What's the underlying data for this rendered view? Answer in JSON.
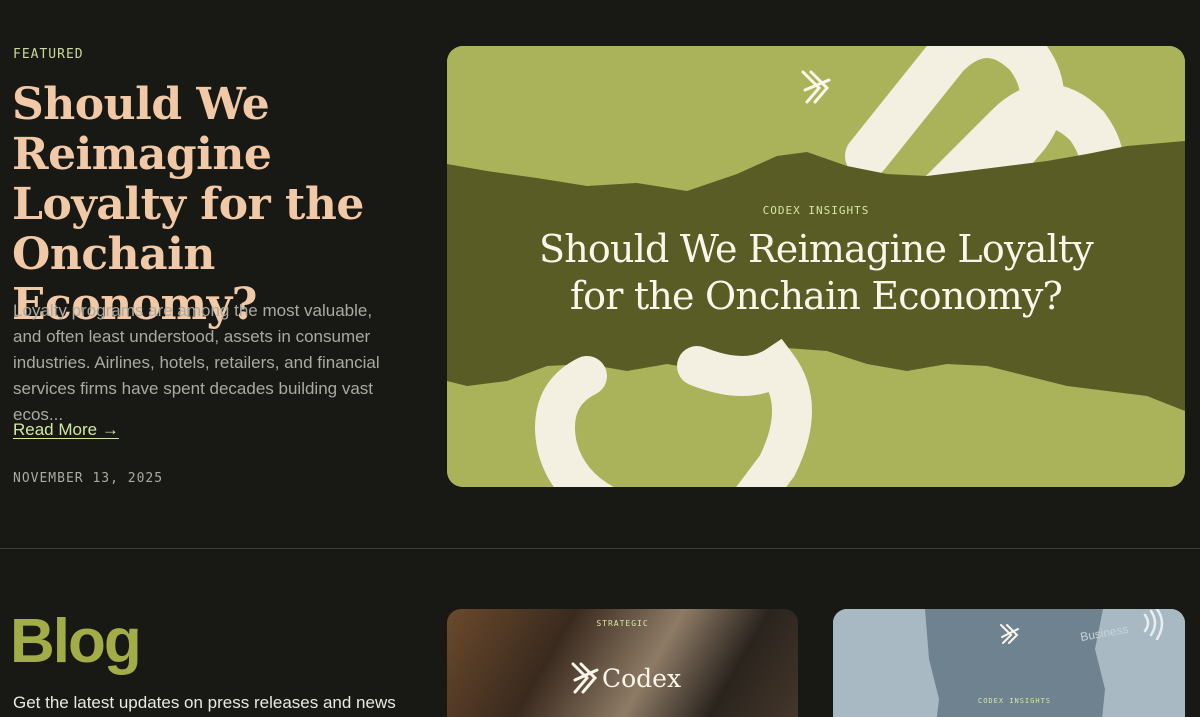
{
  "featured": {
    "label": "FEATURED",
    "title": "Should We Reimagine Loyalty for the Onchain Economy?",
    "excerpt": "Loyalty programs are among the most valuable, and often least understood, assets in consumer industries. Airlines, hotels, retailers, and financial services firms have spent decades building vast ecos...",
    "read_more": "Read More →",
    "date": "NOVEMBER 13, 2025",
    "image": {
      "kicker": "CODEX INSIGHTS",
      "title": "Should We Reimagine Loyalty for the Onchain Economy?",
      "icons": [
        "codex-logo-icon",
        "chain-link-icon"
      ]
    }
  },
  "blog": {
    "title": "Blog",
    "subtitle": "Get the latest updates on press releases and news",
    "cards": [
      {
        "kicker": "STRATEGIC",
        "wordmark": "Codex",
        "icon": "codex-logo-icon"
      },
      {
        "kicker": "CODEX INSIGHTS",
        "card_text": "Business",
        "icons": [
          "codex-logo-icon",
          "contactless-icon"
        ]
      }
    ]
  },
  "colors": {
    "background": "#181914",
    "featured_title": "#f2c9a6",
    "accent_green": "#cfe8a6",
    "blog_title": "#a3ad48",
    "hero_olive": "#aab35a",
    "hero_band": "#5a5c26"
  }
}
